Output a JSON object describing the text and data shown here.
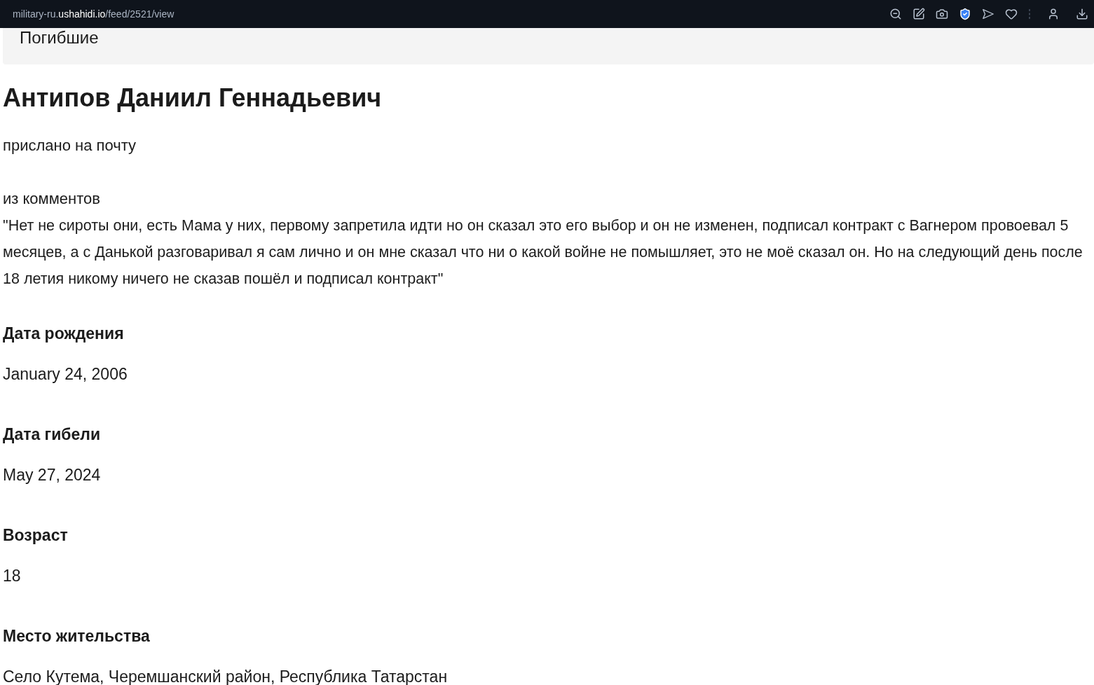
{
  "address_bar": {
    "url_prefix": "military-ru.",
    "url_domain": "ushahidi.io",
    "url_path": "/feed/2521/view"
  },
  "category_card": {
    "label": "Погибшие"
  },
  "post": {
    "title": "Антипов Даниил Геннадьевич",
    "source": "прислано на почту",
    "comment_heading": "из комментов",
    "comment": "\"Нет не сироты они, есть Мама у них, первому запретила идти но он сказал это его выбор и он не изменен, подписал контракт с Вагнером провоевал 5 месяцев, а с Данькой разговаривал я сам лично и он мне сказал что ни о какой войне не помышляет, это не моё сказал он. Но на следующий день после 18 летия никому ничего не сказав пошёл и подписал контракт\""
  },
  "fields": [
    {
      "label": "Дата рождения",
      "value": "January 24, 2006"
    },
    {
      "label": "Дата гибели",
      "value": "May 27, 2024"
    },
    {
      "label": "Возраст",
      "value": "18"
    },
    {
      "label": "Место жительства",
      "value": "Село Кутема, Черемшанский район, Республика Татарстан"
    }
  ]
}
